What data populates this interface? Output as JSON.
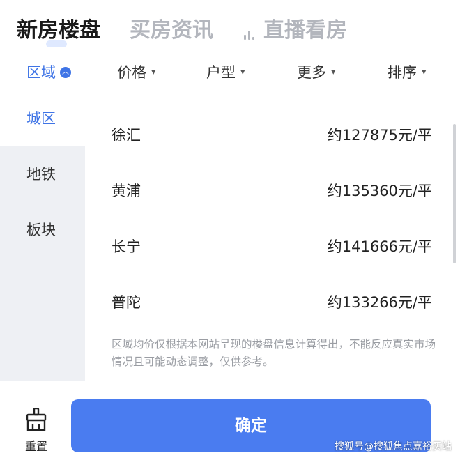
{
  "tabs": {
    "new_homes": "新房楼盘",
    "news": "买房资讯",
    "live": "直播看房"
  },
  "filters": {
    "area": "区域",
    "price": "价格",
    "type": "户型",
    "more": "更多",
    "sort": "排序"
  },
  "sidebar": {
    "items": [
      {
        "label": "城区",
        "active": true
      },
      {
        "label": "地铁",
        "active": false
      },
      {
        "label": "板块",
        "active": false
      }
    ]
  },
  "list": {
    "rows": [
      {
        "name": "徐汇",
        "price": "约127875元/平"
      },
      {
        "name": "黄浦",
        "price": "约135360元/平"
      },
      {
        "name": "长宁",
        "price": "约141666元/平"
      },
      {
        "name": "普陀",
        "price": "约133266元/平"
      }
    ],
    "note": "区域均价仅根据本网站呈现的楼盘信息计算得出，不能反应真实市场情况且可能动态调整，仅供参考。"
  },
  "bottom": {
    "reset": "重置",
    "confirm": "确定",
    "watermark": "搜狐号@搜狐焦点嘉裕买站"
  },
  "colors": {
    "accent": "#3f74e6",
    "confirm_bg": "#4a7cf0",
    "sidebar_bg": "#eef0f4",
    "muted": "#b3b6bd"
  },
  "icons": [
    "live-bars-icon",
    "collapse-circle-icon",
    "chevron-down-icon",
    "broom-icon"
  ]
}
